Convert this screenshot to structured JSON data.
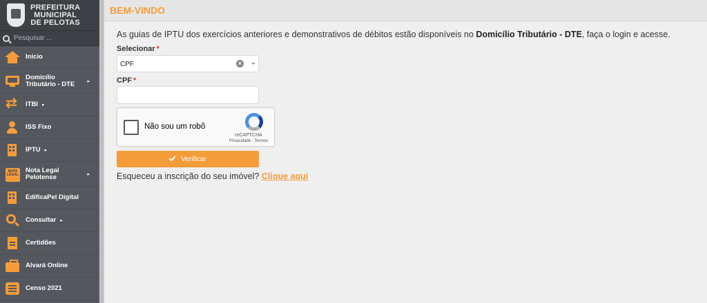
{
  "sidebar": {
    "logo_lines": [
      "PREFEITURA",
      "MUNICIPAL",
      "DE PELOTAS"
    ],
    "search_placeholder": "Pesquisar ...",
    "items": [
      {
        "label": "Início",
        "icon": "home-icon"
      },
      {
        "label_line1": "Domicílio",
        "label_line2": "Tributário - DTE",
        "icon": "monitor-icon",
        "has_submenu": true
      },
      {
        "label": "ITBI",
        "icon": "transfer-arrows-icon",
        "has_submenu": true
      },
      {
        "label": "ISS Fixo",
        "icon": "user-icon"
      },
      {
        "label": "IPTU",
        "icon": "building-icon",
        "has_submenu": true
      },
      {
        "label_line1": "Nota Legal",
        "label_line2": "Pelotense",
        "icon": "nota-legal-icon",
        "icon_text": "NOTA LEGAL",
        "has_submenu": true
      },
      {
        "label": "EdificaPel Digital",
        "icon": "building-icon"
      },
      {
        "label": "Consultar",
        "icon": "search-icon",
        "has_submenu": true
      },
      {
        "label": "Certidões",
        "icon": "document-icon"
      },
      {
        "label": "Alvará Online",
        "icon": "briefcase-icon"
      },
      {
        "label": "Censo 2021",
        "icon": "list-icon"
      }
    ],
    "arrow": "▸"
  },
  "header": {
    "title": "BEM-VINDO"
  },
  "main": {
    "info_text_pre": "As guias de IPTU dos exercícios anteriores e demonstrativos de débitos estão disponíveis no ",
    "info_text_bold": "Domicílio Tributário - DTE",
    "info_text_post": ", faça o login e acesse.",
    "select_label": "Selecionar",
    "select_value": "CPF",
    "cpf_label": "CPF",
    "required_mark": "*",
    "captcha": {
      "text": "Não sou um robô",
      "brand": "reCAPTCHA",
      "links": "Privacidade - Termos"
    },
    "verify_button": "Verificar",
    "forgot_text": "Esqueceu a inscrição do seu imóvel? ",
    "forgot_link": "Clique aqui"
  },
  "colors": {
    "accent": "#f59c3a",
    "sidebar": "#54585e"
  }
}
